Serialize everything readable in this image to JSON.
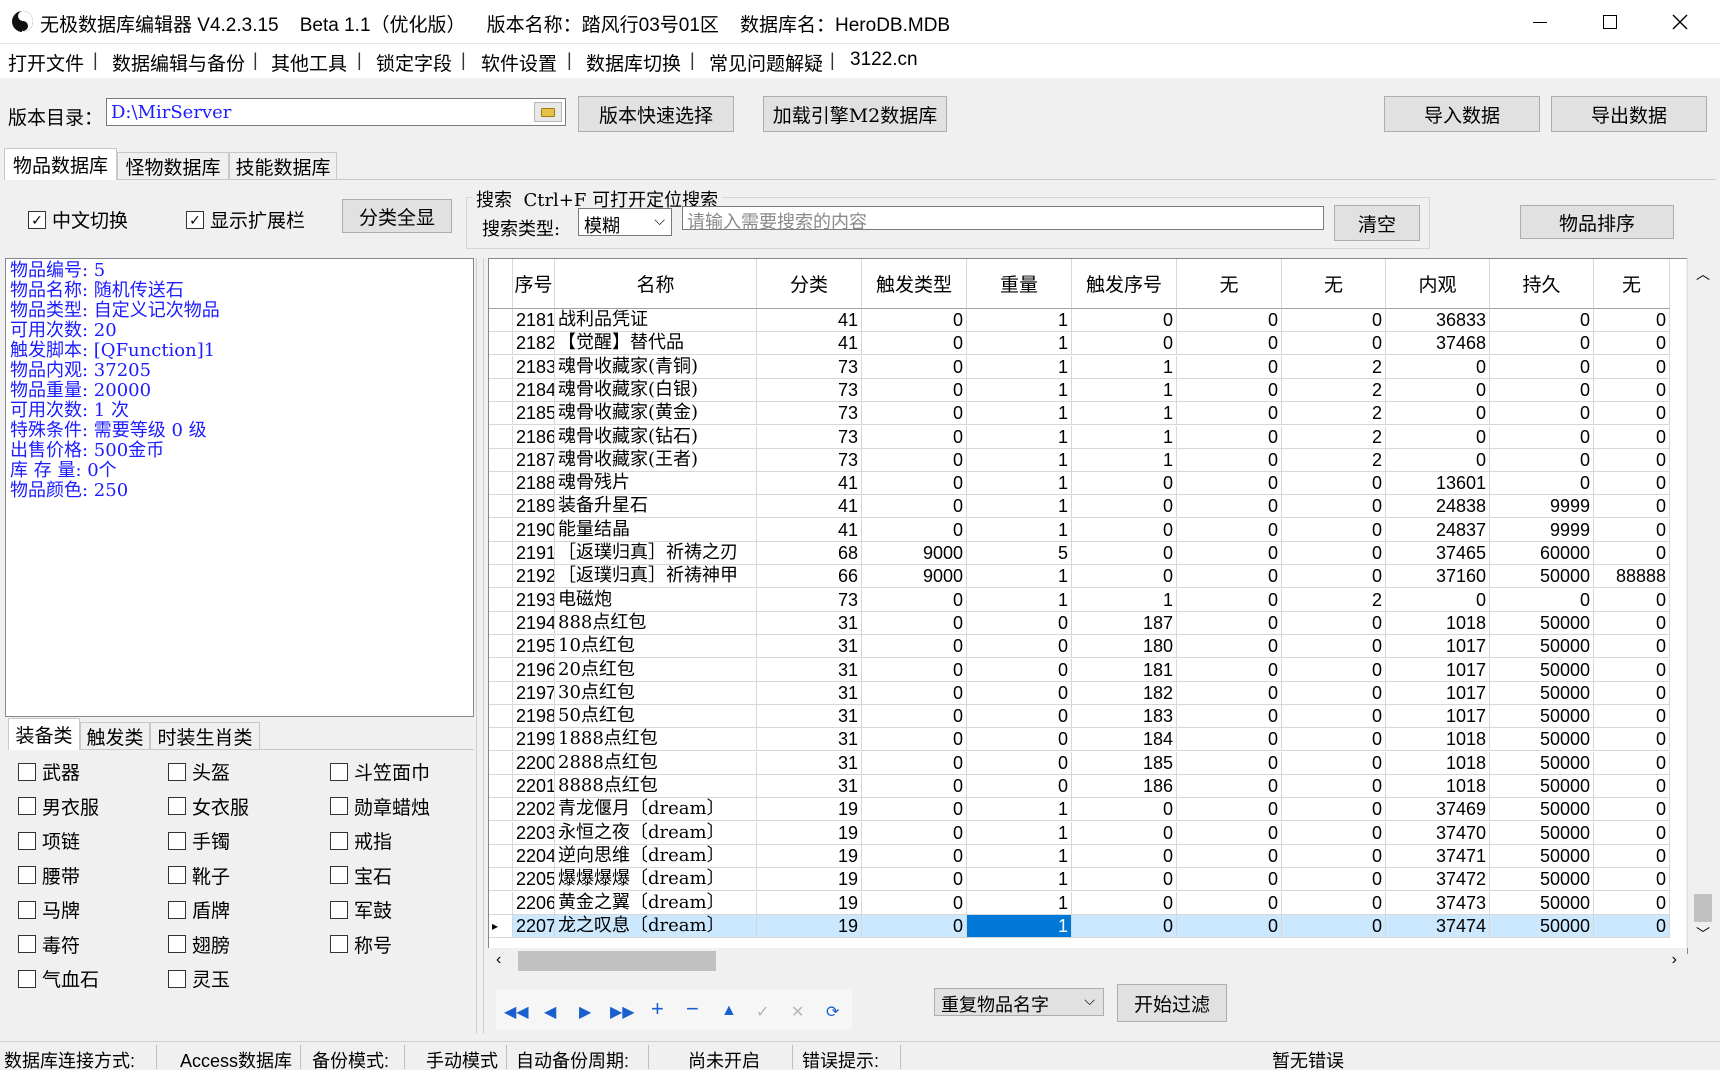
{
  "window": {
    "title": "无极数据库编辑器 V4.2.3.15    Beta 1.1（优化版）    版本名称：踏风行03号01区    数据库名：HeroDB.MDB"
  },
  "menu": [
    "打开文件",
    "数据编辑与备份",
    "其他工具",
    "锁定字段",
    "软件设置",
    "数据库切换",
    "常见问题解疑",
    "3122.cn"
  ],
  "toolbar": {
    "dir_label": "版本目录：",
    "dir_value": "D:\\MirServer",
    "quick_select": "版本快速选择",
    "load_m2": "加载引擎M2数据库",
    "import": "导入数据",
    "export": "导出数据"
  },
  "tabs": [
    "物品数据库",
    "怪物数据库",
    "技能数据库"
  ],
  "options": {
    "chinese_switch": "中文切换",
    "show_ext": "显示扩展栏",
    "show_all": "分类全显"
  },
  "search": {
    "title": "搜索  Ctrl+F 可打开定位搜索",
    "type_label": "搜索类型:",
    "type_value": "模糊",
    "placeholder": "请输入需要搜索的内容",
    "clear": "清空",
    "sort": "物品排序"
  },
  "info": [
    "物品编号: 5",
    "物品名称: 随机传送石",
    "物品类型: 自定义记次物品",
    "可用次数: 20",
    "触发脚本: [QFunction]1",
    "物品内观: 37205",
    "物品重量: 20000",
    "可用次数: 1 次",
    "特殊条件: 需要等级 0 级",
    "出售价格: 500金币",
    "库 存 量: 0个",
    "物品颜色: 250"
  ],
  "cat_tabs": [
    "装备类",
    "触发类",
    "时装生肖类"
  ],
  "categories": [
    [
      "武器",
      "头盔",
      "斗笠面巾"
    ],
    [
      "男衣服",
      "女衣服",
      "勋章蜡烛"
    ],
    [
      "项链",
      "手镯",
      "戒指"
    ],
    [
      "腰带",
      "靴子",
      "宝石"
    ],
    [
      "马牌",
      "盾牌",
      "军鼓"
    ],
    [
      "毒符",
      "翅膀",
      "称号"
    ],
    [
      "气血石",
      "灵玉"
    ]
  ],
  "grid": {
    "headers": [
      "序号",
      "名称",
      "分类",
      "触发类型",
      "重量",
      "触发序号",
      "无",
      "无",
      "内观",
      "持久",
      "无"
    ],
    "rows": [
      [
        "2181",
        "战利品凭证",
        "41",
        "0",
        "1",
        "0",
        "0",
        "0",
        "36833",
        "0",
        "0"
      ],
      [
        "2182",
        "【觉醒】替代品",
        "41",
        "0",
        "1",
        "0",
        "0",
        "0",
        "37468",
        "0",
        "0"
      ],
      [
        "2183",
        "魂骨收藏家(青铜)",
        "73",
        "0",
        "1",
        "1",
        "0",
        "2",
        "0",
        "0",
        "0"
      ],
      [
        "2184",
        "魂骨收藏家(白银)",
        "73",
        "0",
        "1",
        "1",
        "0",
        "2",
        "0",
        "0",
        "0"
      ],
      [
        "2185",
        "魂骨收藏家(黄金)",
        "73",
        "0",
        "1",
        "1",
        "0",
        "2",
        "0",
        "0",
        "0"
      ],
      [
        "2186",
        "魂骨收藏家(钻石)",
        "73",
        "0",
        "1",
        "1",
        "0",
        "2",
        "0",
        "0",
        "0"
      ],
      [
        "2187",
        "魂骨收藏家(王者)",
        "73",
        "0",
        "1",
        "1",
        "0",
        "2",
        "0",
        "0",
        "0"
      ],
      [
        "2188",
        "魂骨残片",
        "41",
        "0",
        "1",
        "0",
        "0",
        "0",
        "13601",
        "0",
        "0"
      ],
      [
        "2189",
        "装备升星石",
        "41",
        "0",
        "1",
        "0",
        "0",
        "0",
        "24838",
        "9999",
        "0"
      ],
      [
        "2190",
        "能量结晶",
        "41",
        "0",
        "1",
        "0",
        "0",
        "0",
        "24837",
        "9999",
        "0"
      ],
      [
        "2191",
        "［返璞归真］祈祷之刃",
        "68",
        "9000",
        "5",
        "0",
        "0",
        "0",
        "37465",
        "60000",
        "0"
      ],
      [
        "2192",
        "［返璞归真］祈祷神甲",
        "66",
        "9000",
        "1",
        "0",
        "0",
        "0",
        "37160",
        "50000",
        "88888"
      ],
      [
        "2193",
        "电磁炮",
        "73",
        "0",
        "1",
        "1",
        "0",
        "2",
        "0",
        "0",
        "0"
      ],
      [
        "2194",
        "888点红包",
        "31",
        "0",
        "0",
        "187",
        "0",
        "0",
        "1018",
        "50000",
        "0"
      ],
      [
        "2195",
        "10点红包",
        "31",
        "0",
        "0",
        "180",
        "0",
        "0",
        "1017",
        "50000",
        "0"
      ],
      [
        "2196",
        "20点红包",
        "31",
        "0",
        "0",
        "181",
        "0",
        "0",
        "1017",
        "50000",
        "0"
      ],
      [
        "2197",
        "30点红包",
        "31",
        "0",
        "0",
        "182",
        "0",
        "0",
        "1017",
        "50000",
        "0"
      ],
      [
        "2198",
        "50点红包",
        "31",
        "0",
        "0",
        "183",
        "0",
        "0",
        "1017",
        "50000",
        "0"
      ],
      [
        "2199",
        "1888点红包",
        "31",
        "0",
        "0",
        "184",
        "0",
        "0",
        "1018",
        "50000",
        "0"
      ],
      [
        "2200",
        "2888点红包",
        "31",
        "0",
        "0",
        "185",
        "0",
        "0",
        "1018",
        "50000",
        "0"
      ],
      [
        "2201",
        "8888点红包",
        "31",
        "0",
        "0",
        "186",
        "0",
        "0",
        "1018",
        "50000",
        "0"
      ],
      [
        "2202",
        "青龙偃月〔dream〕",
        "19",
        "0",
        "1",
        "0",
        "0",
        "0",
        "37469",
        "50000",
        "0"
      ],
      [
        "2203",
        "永恒之夜〔dream〕",
        "19",
        "0",
        "1",
        "0",
        "0",
        "0",
        "37470",
        "50000",
        "0"
      ],
      [
        "2204",
        "逆向思维〔dream〕",
        "19",
        "0",
        "1",
        "0",
        "0",
        "0",
        "37471",
        "50000",
        "0"
      ],
      [
        "2205",
        "爆爆爆爆〔dream〕",
        "19",
        "0",
        "1",
        "0",
        "0",
        "0",
        "37472",
        "50000",
        "0"
      ],
      [
        "2206",
        "黄金之翼〔dream〕",
        "19",
        "0",
        "1",
        "0",
        "0",
        "0",
        "37473",
        "50000",
        "0"
      ],
      [
        "2207",
        "龙之叹息〔dream〕",
        "19",
        "0",
        "1",
        "0",
        "0",
        "0",
        "37474",
        "50000",
        "0"
      ]
    ],
    "selected_row": 26
  },
  "filter": {
    "value": "重复物品名字",
    "start": "开始过滤"
  },
  "status": {
    "conn_label": "数据库连接方式:",
    "conn_value": "Access数据库",
    "backup_label": "备份模式:",
    "backup_value": "手动模式",
    "auto_label": "自动备份周期:",
    "auto_value": "尚未开启",
    "err_label": "错误提示:",
    "err_value": "暂无错误"
  },
  "colors": {
    "info_text": "#1c1cff",
    "selection": "#cce8ff",
    "current_cell": "#0078d7",
    "nav_icons": "#1a5fd0"
  }
}
